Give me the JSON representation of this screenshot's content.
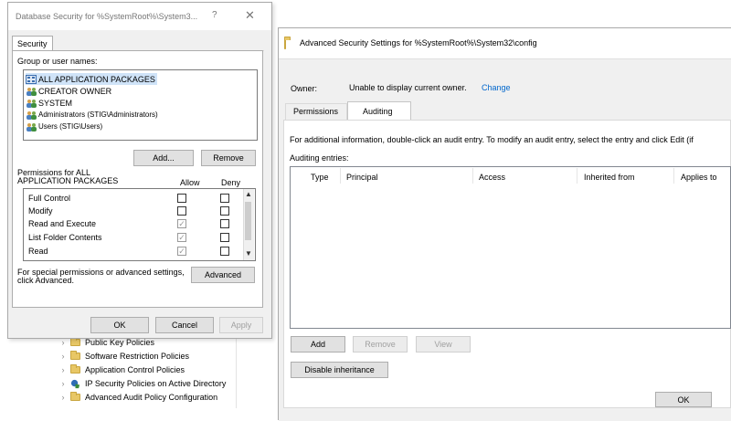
{
  "tree": {
    "items": [
      {
        "label": "Public Key Policies",
        "icon": "folder-icon"
      },
      {
        "label": "Software Restriction Policies",
        "icon": "folder-icon"
      },
      {
        "label": "Application Control Policies",
        "icon": "folder-icon"
      },
      {
        "label": "IP Security Policies on Active Directory",
        "icon": "security-policy-icon"
      },
      {
        "label": "Advanced Audit Policy Configuration",
        "icon": "folder-icon"
      }
    ]
  },
  "security_dialog": {
    "title": "Database Security for %SystemRoot%\\System3...",
    "help_glyph": "?",
    "close_glyph": "✕",
    "tab": "Security",
    "group_label": "Group or user names:",
    "users": [
      {
        "name": "ALL APPLICATION PACKAGES",
        "icon": "app-packages-icon",
        "selected": true
      },
      {
        "name": "CREATOR OWNER",
        "icon": "users-icon",
        "selected": false
      },
      {
        "name": "SYSTEM",
        "icon": "users-icon",
        "selected": false
      },
      {
        "name": "Administrators (STIG\\Administrators)",
        "icon": "users-icon",
        "selected": false
      },
      {
        "name": "Users (STIG\\Users)",
        "icon": "users-icon",
        "selected": false
      }
    ],
    "add_button": "Add...",
    "remove_button": "Remove",
    "permissions_label_line1": "Permissions for ALL",
    "permissions_label_line2": "APPLICATION PACKAGES",
    "allow_header": "Allow",
    "deny_header": "Deny",
    "permissions": [
      {
        "name": "Full Control",
        "allow": false,
        "deny": false
      },
      {
        "name": "Modify",
        "allow": false,
        "deny": false
      },
      {
        "name": "Read and Execute",
        "allow": true,
        "deny": false
      },
      {
        "name": "List Folder Contents",
        "allow": true,
        "deny": false
      },
      {
        "name": "Read",
        "allow": true,
        "deny": false
      }
    ],
    "special_line1": "For special permissions or advanced settings,",
    "special_line2": "click Advanced.",
    "advanced_button": "Advanced",
    "ok_button": "OK",
    "cancel_button": "Cancel",
    "apply_button": "Apply"
  },
  "advanced_dialog": {
    "title": "Advanced Security Settings for %SystemRoot%\\System32\\config",
    "owner_label": "Owner:",
    "owner_value": "Unable to display current owner.",
    "owner_change_link": "Change",
    "tabs": [
      {
        "label": "Permissions",
        "active": false
      },
      {
        "label": "Auditing",
        "active": true
      }
    ],
    "info_text": "For additional information, double-click an audit entry. To modify an audit entry, select the entry and click Edit (if",
    "entries_label": "Auditing entries:",
    "columns": [
      "Type",
      "Principal",
      "Access",
      "Inherited from",
      "Applies to"
    ],
    "add_button": "Add",
    "remove_button": "Remove",
    "view_button": "View",
    "disable_inheritance_button": "Disable inheritance",
    "ok_button": "OK"
  },
  "colors": {
    "selection": "#cfe3f8",
    "link": "#0066cc",
    "dialog_bg": "#f0f0f0",
    "button_bg": "#e1e1e1",
    "folder": "#e8c766"
  }
}
